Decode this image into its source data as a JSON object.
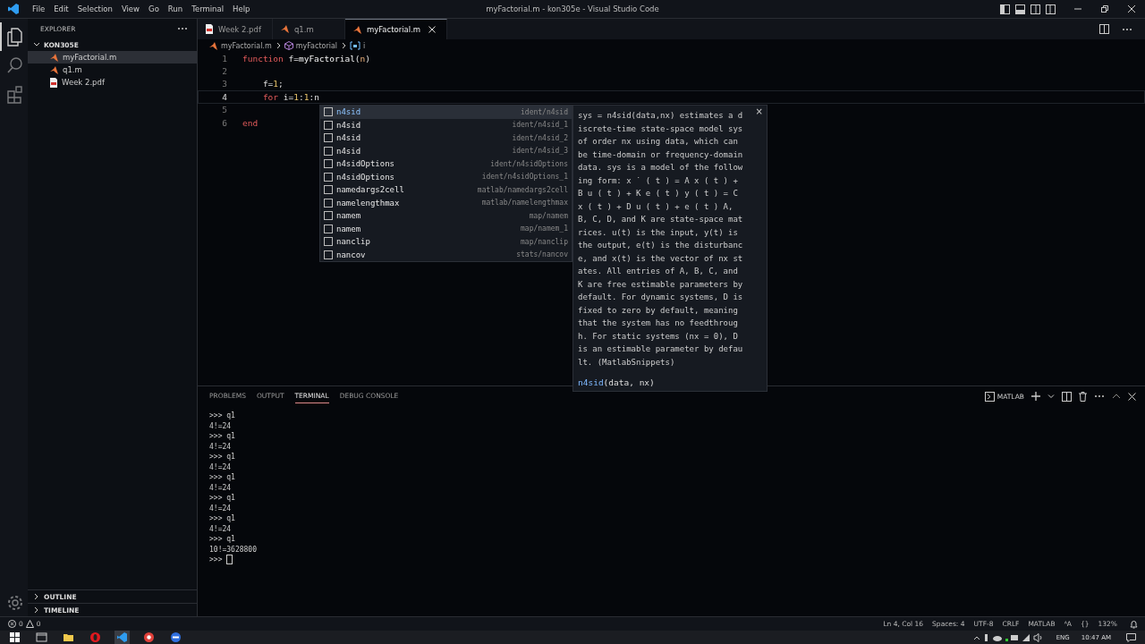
{
  "window": {
    "title": "myFactorial.m - kon305e - Visual Studio Code"
  },
  "menu": [
    "File",
    "Edit",
    "Selection",
    "View",
    "Go",
    "Run",
    "Terminal",
    "Help"
  ],
  "activity_bar": [
    {
      "kind": "files",
      "selected": true
    },
    {
      "kind": "search",
      "selected": false
    },
    {
      "kind": "extensions",
      "selected": false
    }
  ],
  "sidebar": {
    "title": "EXPLORER",
    "folder": {
      "name": "KON305E",
      "expanded": true,
      "children": [
        {
          "name": "myFactorial.m",
          "kind": "matlab",
          "selected": true
        },
        {
          "name": "q1.m",
          "kind": "matlab",
          "selected": false
        },
        {
          "name": "Week 2.pdf",
          "kind": "pdf",
          "selected": false
        }
      ]
    },
    "sections": [
      {
        "name": "OUTLINE",
        "expanded": false
      },
      {
        "name": "TIMELINE",
        "expanded": false
      }
    ]
  },
  "tabs": [
    {
      "label": "Week 2.pdf",
      "kind": "pdf",
      "selected": false
    },
    {
      "label": "q1.m",
      "kind": "matlab",
      "selected": false
    },
    {
      "label": "myFactorial.m",
      "kind": "matlab",
      "selected": true
    }
  ],
  "breadcrumbs": [
    {
      "label": "myFactorial.m",
      "kind": "file"
    },
    {
      "label": "myFactorial",
      "kind": "function"
    },
    {
      "label": "i",
      "kind": "variable"
    }
  ],
  "editor": {
    "lines": [
      {
        "number": "1",
        "current": false,
        "tokens": [
          {
            "text": "function",
            "kind": "keyword"
          },
          {
            "text": " f=",
            "kind": "plain"
          },
          {
            "text": "myFactorial",
            "kind": "func"
          },
          {
            "text": "(",
            "kind": "plain"
          },
          {
            "text": "n",
            "kind": "param"
          },
          {
            "text": ")",
            "kind": "plain"
          }
        ]
      },
      {
        "number": "2",
        "current": false
      },
      {
        "number": "3",
        "current": false,
        "tokens": [
          {
            "text": "    f=",
            "kind": "plain"
          },
          {
            "text": "1",
            "kind": "number"
          },
          {
            "text": ";",
            "kind": "plain"
          }
        ]
      },
      {
        "number": "4",
        "current": true,
        "tokens": [
          {
            "text": "    for",
            "kind": "keyword"
          },
          {
            "text": " i=",
            "kind": "plain"
          },
          {
            "text": "1",
            "kind": "number"
          },
          {
            "text": ":",
            "kind": "plain"
          },
          {
            "text": "1",
            "kind": "number"
          },
          {
            "text": ":n",
            "kind": "plain"
          }
        ]
      },
      {
        "number": "5",
        "current": false
      },
      {
        "number": "6",
        "current": false,
        "tokens": [
          {
            "text": "end",
            "kind": "keyword"
          }
        ]
      }
    ]
  },
  "suggestions": [
    {
      "label": "n4sid",
      "detail": "ident/n4sid",
      "selected": true
    },
    {
      "label": "n4sid",
      "detail": "ident/n4sid_1",
      "selected": false
    },
    {
      "label": "n4sid",
      "detail": "ident/n4sid_2",
      "selected": false
    },
    {
      "label": "n4sid",
      "detail": "ident/n4sid_3",
      "selected": false
    },
    {
      "label": "n4sidOptions",
      "detail": "ident/n4sidOptions",
      "selected": false
    },
    {
      "label": "n4sidOptions",
      "detail": "ident/n4sidOptions_1",
      "selected": false
    },
    {
      "label": "namedargs2cell",
      "detail": "matlab/namedargs2cell",
      "selected": false
    },
    {
      "label": "namelengthmax",
      "detail": "matlab/namelengthmax",
      "selected": false
    },
    {
      "label": "namem",
      "detail": "map/namem",
      "selected": false
    },
    {
      "label": "namem",
      "detail": "map/namem_1",
      "selected": false
    },
    {
      "label": "nanclip",
      "detail": "map/nanclip",
      "selected": false
    },
    {
      "label": "nancov",
      "detail": "stats/nancov",
      "selected": false
    }
  ],
  "suggestion_doc": {
    "close": "×",
    "text": "sys = n4sid(data,nx) estimates a discrete-time state-space model sys of order nx using data, which can be time-domain or frequency-domain data. sys is a model of the following form: x ˙ ( t ) = A x ( t ) + B u ( t ) + K e ( t ) y ( t ) = C x ( t ) + D u ( t ) + e ( t ) A, B, C, D, and K are state-space matrices. u(t) is the input, y(t) is the output, e(t) is the disturbance, and x(t) is the vector of nx states. All entries of A, B, C, and K are free estimable parameters by default. For dynamic systems, D is fixed to zero by default, meaning that the system has no feedthrough. For static systems (nx = 0), D is an estimable parameter by default. (MatlabSnippets)",
    "signature_name": "n4sid",
    "signature_args": "(data, nx)"
  },
  "panel": {
    "tabs": [
      {
        "label": "PROBLEMS",
        "selected": false
      },
      {
        "label": "OUTPUT",
        "selected": false
      },
      {
        "label": "TERMINAL",
        "selected": true
      },
      {
        "label": "DEBUG CONSOLE",
        "selected": false
      }
    ],
    "terminal_name": "MATLAB",
    "terminal_lines": [
      ">>> q1",
      "4!=24",
      ">>> q1",
      "4!=24",
      ">>> q1",
      "4!=24",
      ">>> q1",
      "4!=24",
      ">>> q1",
      "4!=24",
      ">>> q1",
      "4!=24",
      ">>> q1",
      "10!=3628800"
    ],
    "prompt": ">>> "
  },
  "status_bar": {
    "errors": "0",
    "warnings": "0",
    "items": [
      "Ln 4, Col 16",
      "Spaces: 4",
      "UTF-8",
      "CRLF",
      "MATLAB",
      "ᴬA",
      "{}",
      "132%"
    ]
  },
  "taskbar": {
    "apps": [
      {
        "kind": "start"
      },
      {
        "kind": "terminal"
      },
      {
        "kind": "folder"
      },
      {
        "kind": "opera"
      },
      {
        "kind": "vscode",
        "selected": true
      },
      {
        "kind": "record"
      },
      {
        "kind": "chat"
      }
    ],
    "language": "ENG",
    "time": "10:47 AM"
  }
}
